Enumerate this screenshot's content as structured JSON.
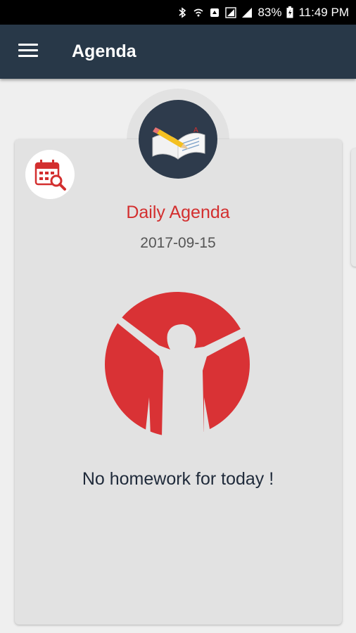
{
  "status_bar": {
    "battery": "83%",
    "time": "11:49 PM"
  },
  "app_bar": {
    "title": "Agenda"
  },
  "card": {
    "title": "Daily Agenda",
    "date": "2017-09-15",
    "message": "No homework for today !"
  },
  "icons": {
    "menu": "menu-icon",
    "book": "book-pencil-icon",
    "calendar_search": "calendar-search-icon",
    "illustration": "celebrating-person-icon"
  },
  "colors": {
    "app_bar": "#283848",
    "accent_red": "#d32f2f",
    "card_bg": "#e2e2e2"
  }
}
